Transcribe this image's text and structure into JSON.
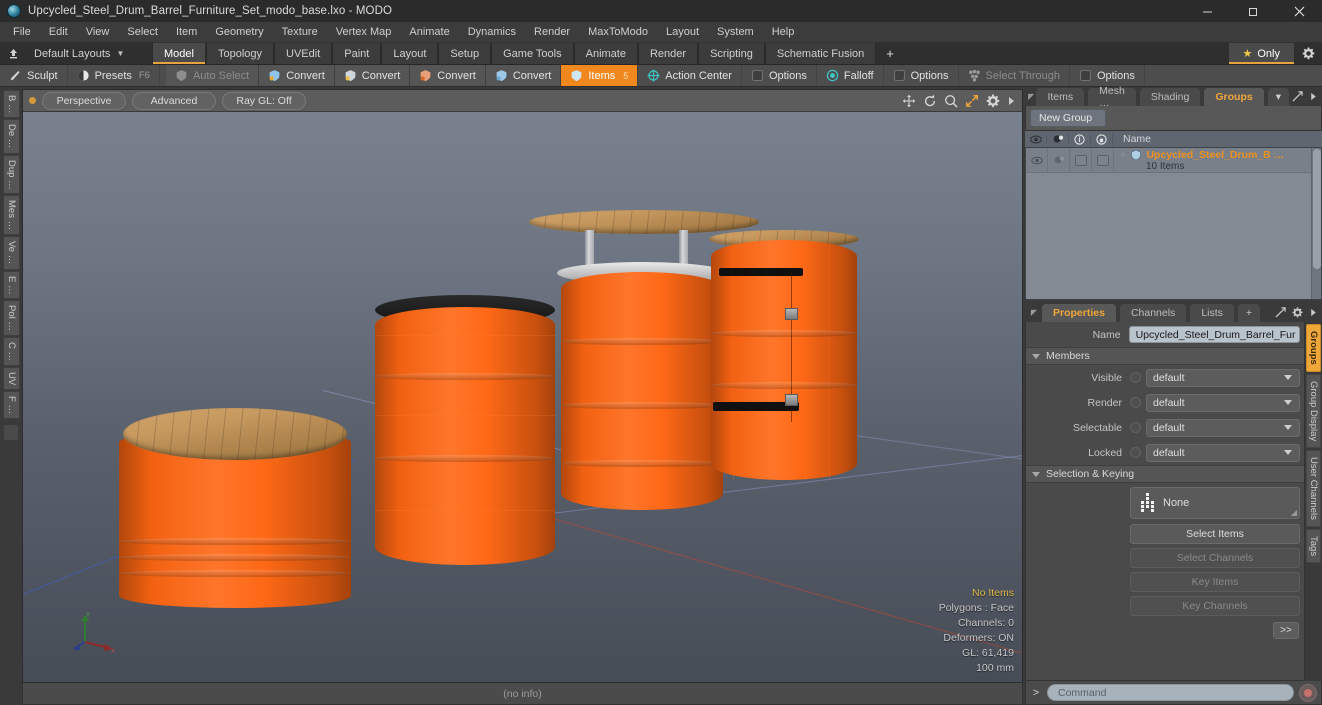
{
  "window": {
    "title": "Upcycled_Steel_Drum_Barrel_Furniture_Set_modo_base.lxo - MODO",
    "minimize": "—",
    "maximize": "▢",
    "close": "✕"
  },
  "menu": [
    "File",
    "Edit",
    "View",
    "Select",
    "Item",
    "Geometry",
    "Texture",
    "Vertex Map",
    "Animate",
    "Dynamics",
    "Render",
    "MaxToModo",
    "Layout",
    "System",
    "Help"
  ],
  "layoutbar": {
    "layout_name": "Default Layouts",
    "tabs": [
      "Model",
      "Topology",
      "UVEdit",
      "Paint",
      "Layout",
      "Setup",
      "Game Tools",
      "Animate",
      "Render",
      "Scripting",
      "Schematic Fusion"
    ],
    "active_tab": "Model",
    "plus": "+",
    "only_label": "Only",
    "star": "★"
  },
  "toolbar": [
    {
      "label": "Sculpt",
      "icon": "brush-icon",
      "state": "normal",
      "hotkey": ""
    },
    {
      "label": "Presets",
      "icon": "presets-icon",
      "state": "normal",
      "hotkey": "F6"
    },
    {
      "label": "Auto Select",
      "icon": "autoselect-icon",
      "state": "dim",
      "hotkey": ""
    },
    {
      "label": "Convert",
      "icon": "convert-icon",
      "state": "normal",
      "hotkey": ""
    },
    {
      "label": "Convert",
      "icon": "convert-icon",
      "state": "normal",
      "hotkey": ""
    },
    {
      "label": "Convert",
      "icon": "convert-icon",
      "state": "normal",
      "hotkey": ""
    },
    {
      "label": "Convert",
      "icon": "convert-icon",
      "state": "normal",
      "hotkey": ""
    },
    {
      "label": "Items",
      "icon": "items-icon",
      "state": "active",
      "hotkey": "5"
    },
    {
      "label": "Action Center",
      "icon": "action-center-icon",
      "state": "normal",
      "hotkey": ""
    },
    {
      "label": "Options",
      "icon": "checkbox-icon",
      "state": "normal",
      "hotkey": ""
    },
    {
      "label": "Falloff",
      "icon": "falloff-icon",
      "state": "normal",
      "hotkey": ""
    },
    {
      "label": "Options",
      "icon": "checkbox-icon",
      "state": "normal",
      "hotkey": ""
    },
    {
      "label": "Select Through",
      "icon": "select-through-icon",
      "state": "dim",
      "hotkey": ""
    },
    {
      "label": "Options",
      "icon": "checkbox-icon",
      "state": "normal",
      "hotkey": ""
    }
  ],
  "left_tabs": [
    "B …",
    "De …",
    "Dup …",
    "Mes …",
    "Ve …",
    "E …",
    "Pol …",
    "C …",
    "UV",
    "F …"
  ],
  "viewport": {
    "projection": "Perspective",
    "shading": "Advanced",
    "raygl": "Ray GL: Off",
    "controls": [
      "pan-icon",
      "rotate-icon",
      "zoom-icon",
      "fit-icon",
      "gear-icon",
      "chevron-right-icon"
    ],
    "info": {
      "selection": "No Items",
      "polygons": "Polygons : Face",
      "channels": "Channels: 0",
      "deformers": "Deformers: ON",
      "gl": "GL: 61,419",
      "scale": "100 mm"
    },
    "status": "(no info)",
    "axis": {
      "x": "X",
      "y": "Y",
      "z": "Z"
    }
  },
  "right_panel": {
    "top_tabs": [
      "Items",
      "Mesh …",
      "Shading",
      "Groups"
    ],
    "top_tabs_active": "Groups",
    "top_tabs_extra": "▾",
    "new_group_button": "New Group",
    "list": {
      "columns": [
        "visible-eye-icon",
        "render-icon",
        "info-icon",
        "lock-icon",
        "Name"
      ],
      "name_header": "Name",
      "rows": [
        {
          "name": "Upcycled_Steel_Drum_B …",
          "sub": "10 Items",
          "expander": "+"
        }
      ]
    },
    "prop_tabs": [
      "Properties",
      "Channels",
      "Lists"
    ],
    "prop_tabs_active": "Properties",
    "prop_tabs_plus": "+",
    "properties": {
      "name_label": "Name",
      "name_value": "Upcycled_Steel_Drum_Barrel_Fur",
      "members_header": "Members",
      "rows": [
        {
          "label": "Visible",
          "value": "default"
        },
        {
          "label": "Render",
          "value": "default"
        },
        {
          "label": "Selectable",
          "value": "default"
        },
        {
          "label": "Locked",
          "value": "default"
        }
      ],
      "selection_header": "Selection & Keying",
      "none_value": "None",
      "buttons": [
        {
          "label": "Select Items",
          "enabled": true
        },
        {
          "label": "Select Channels",
          "enabled": false
        },
        {
          "label": "Key Items",
          "enabled": false
        },
        {
          "label": "Key Channels",
          "enabled": false
        }
      ],
      "more_button": ">>"
    },
    "side_tabs": [
      "Groups",
      "Group Display",
      "User Channels",
      "Tags"
    ],
    "side_tabs_active": "Groups"
  },
  "command_bar": {
    "prompt": ">",
    "placeholder": "Command",
    "record_icon": "record-icon"
  },
  "colors": {
    "accent_orange": "#f0a73a",
    "active_tool": "#f0881e",
    "barrel_orange": "#ff6612",
    "wood": "#c79a60",
    "panel_bg": "#4a4a4a",
    "viewport_sky": "#7b8290"
  }
}
